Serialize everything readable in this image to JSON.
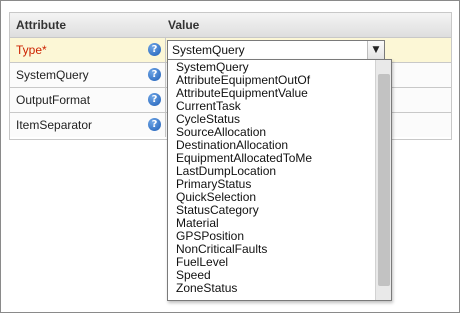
{
  "table": {
    "header_attribute": "Attribute",
    "header_value": "Value",
    "rows": [
      {
        "label": "Type*",
        "required": true
      },
      {
        "label": "SystemQuery",
        "required": false
      },
      {
        "label": "OutputFormat",
        "required": false
      },
      {
        "label": "ItemSeparator",
        "required": false
      }
    ],
    "help_icon": "help-icon",
    "help_glyph": "?"
  },
  "type_select": {
    "selected": "SystemQuery",
    "arrow_icon": "chevron-down-icon",
    "arrow_glyph": "▼"
  },
  "dropdown": {
    "options": [
      "SystemQuery",
      "AttributeEquipmentOutOf",
      "AttributeEquipmentValue",
      "CurrentTask",
      "CycleStatus",
      "SourceAllocation",
      "DestinationAllocation",
      "EquipmentAllocatedToMe",
      "LastDumpLocation",
      "PrimaryStatus",
      "QuickSelection",
      "StatusCategory",
      "Material",
      "GPSPosition",
      "NonCriticalFaults",
      "FuelLevel",
      "Speed",
      "ZoneStatus"
    ]
  },
  "colors": {
    "selected_row_bg": "#fcf7d6",
    "required_label": "#cc2200",
    "help_icon": "#1f5fb8"
  }
}
